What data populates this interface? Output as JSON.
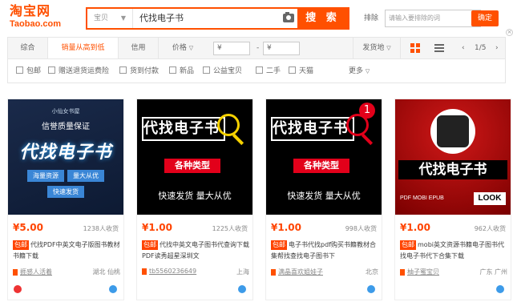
{
  "logo": {
    "cn": "淘宝网",
    "en": "Taobao.com"
  },
  "search": {
    "type": "宝贝",
    "query": "代找电子书",
    "button": "搜 索"
  },
  "exclude": {
    "label": "排除",
    "placeholder": "请输入要排除的词",
    "button": "确定"
  },
  "sortbar": {
    "items": [
      "综合",
      "销量从高到低",
      "信用",
      "价格"
    ],
    "price_from": "¥",
    "price_to": "¥",
    "dash": "-",
    "ship_from": "发货地",
    "page": "1/5"
  },
  "filters": [
    "包邮",
    "赠送退货运费险",
    "货到付款",
    "新品",
    "公益宝贝",
    "二手",
    "天猫"
  ],
  "more": "更多",
  "cards": [
    {
      "thumb_top": "小仙女书屋",
      "thumb_sub": "信誉质量保证",
      "thumb_main": "代找电子书",
      "tags": [
        "海量资源",
        "量大从优",
        "快速发货"
      ],
      "price": "¥5.00",
      "sales": "1238人收货",
      "title_pre": "",
      "title": "代找PDF中英文电子版图书教材书籍下载",
      "shop": "捱感人活着",
      "location": "湖北 仙桃"
    },
    {
      "thumb_main": "代找电子书",
      "thumb_type": "各种类型",
      "thumb_bottom": "快速发货 量大从优",
      "price": "¥1.00",
      "sales": "1225人收货",
      "title_pre": "包邮",
      "title": "代找中英文电子图书代查询下载PDF读秀超星深圳文",
      "shop": "tb5560236649",
      "location": "上海"
    },
    {
      "thumb_main": "代找电子书",
      "thumb_type": "各种类型",
      "thumb_bottom": "快速发货 量大从优",
      "badge": "1",
      "price": "¥1.00",
      "sales": "998人收货",
      "title_pre": "包邮",
      "title": "电子书代找pdf购买书籍教材合集帮找查找电子图书下",
      "shop": "满晶喜欢姐娃子",
      "location": "北京"
    },
    {
      "thumb_main": "代找电子书",
      "thumb_formats": "PDF MOBI EPUB",
      "thumb_look": "LOOK",
      "price": "¥1.00",
      "sales": "962人收货",
      "title_pre": "包邮",
      "title": "mobi英文资源书籍电子图书代找电子书代下合集下载",
      "shop": "柚子蜜宝贝",
      "location": "广东 广州"
    }
  ]
}
